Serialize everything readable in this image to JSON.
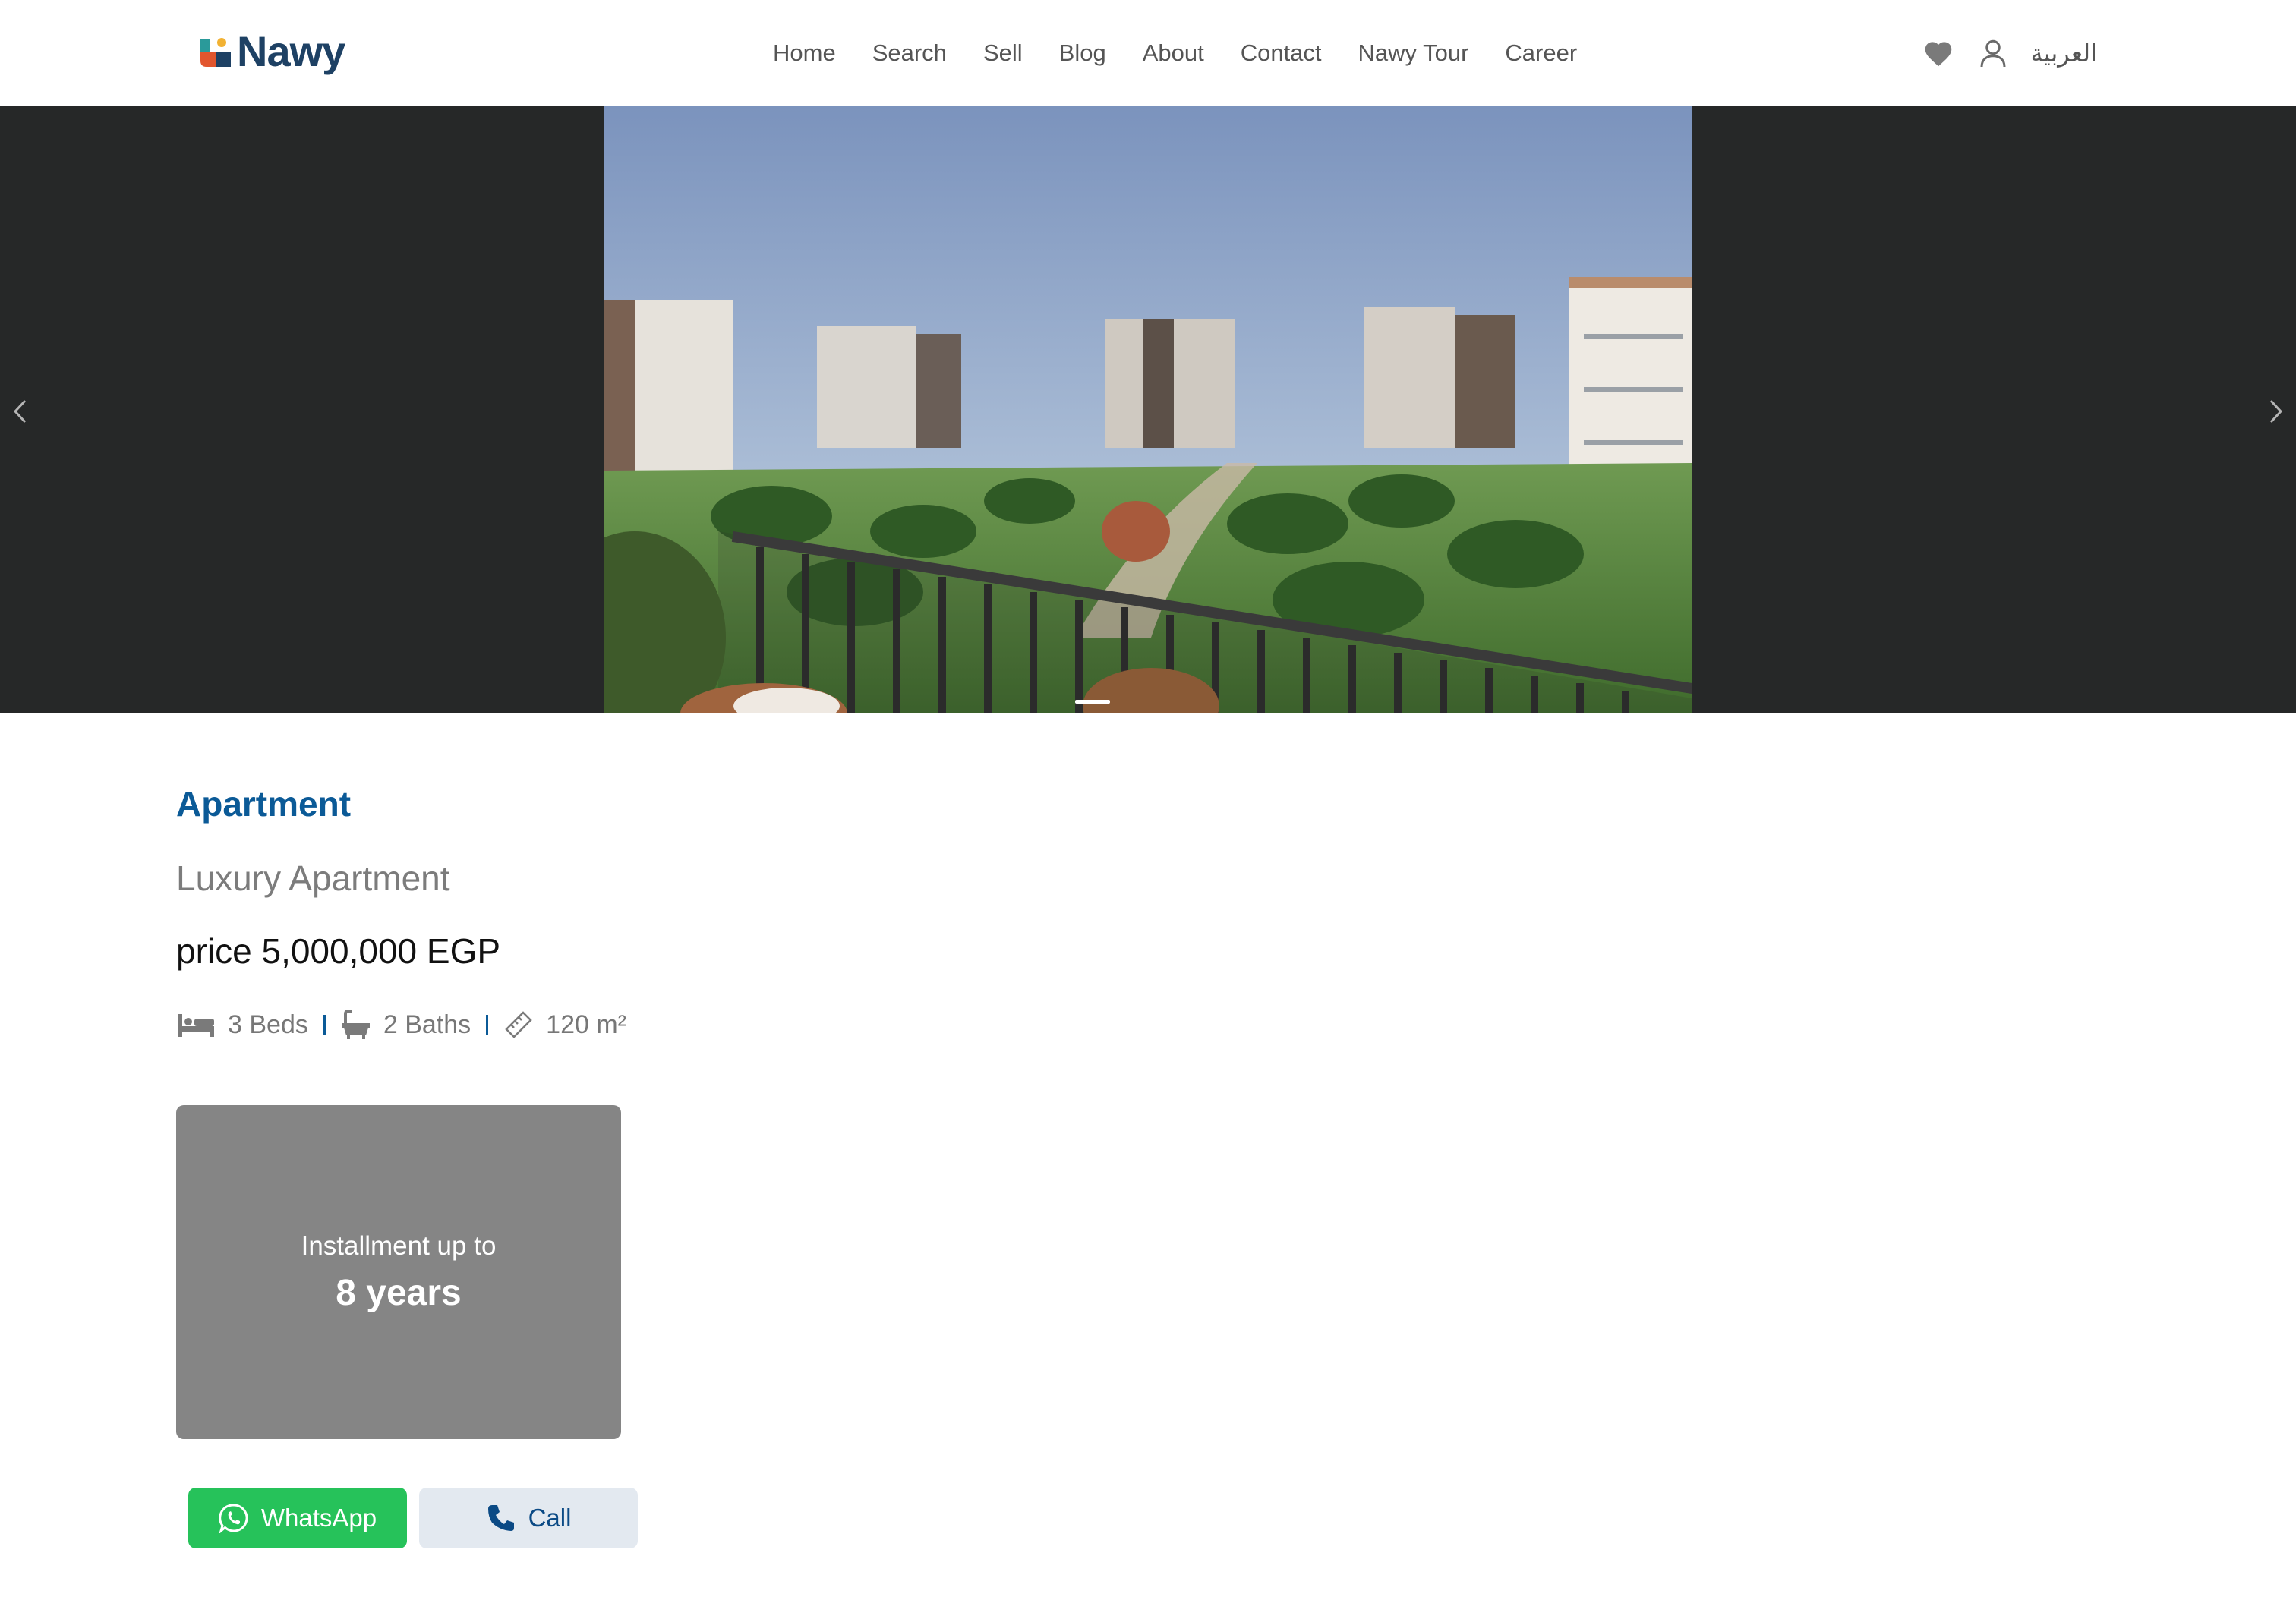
{
  "brand": {
    "name": "Nawy",
    "color": "#1e4164"
  },
  "nav": {
    "items": [
      "Home",
      "Search",
      "Sell",
      "Blog",
      "About",
      "Contact",
      "Nawy Tour",
      "Career"
    ]
  },
  "header": {
    "language_label": "العربية",
    "favorites_icon": "heart-icon",
    "account_icon": "user-icon"
  },
  "hero": {
    "image_description_icon": "property-photo",
    "prev_icon": "chevron-left-icon",
    "next_icon": "chevron-right-icon",
    "slide_count_visible": 1
  },
  "listing": {
    "type": "Apartment",
    "title": "Luxury Apartment",
    "price": "price 5,000,000 EGP",
    "beds": "3 Beds",
    "baths": "2 Baths",
    "area": "120 m²"
  },
  "installment": {
    "label": "Installment up to",
    "value": "8 years"
  },
  "actions": {
    "whatsapp_label": "WhatsApp",
    "call_label": "Call"
  },
  "colors": {
    "accent": "#0b5a97",
    "whatsapp": "#26c25a",
    "card": "#858585",
    "hero_bg": "#262828"
  }
}
